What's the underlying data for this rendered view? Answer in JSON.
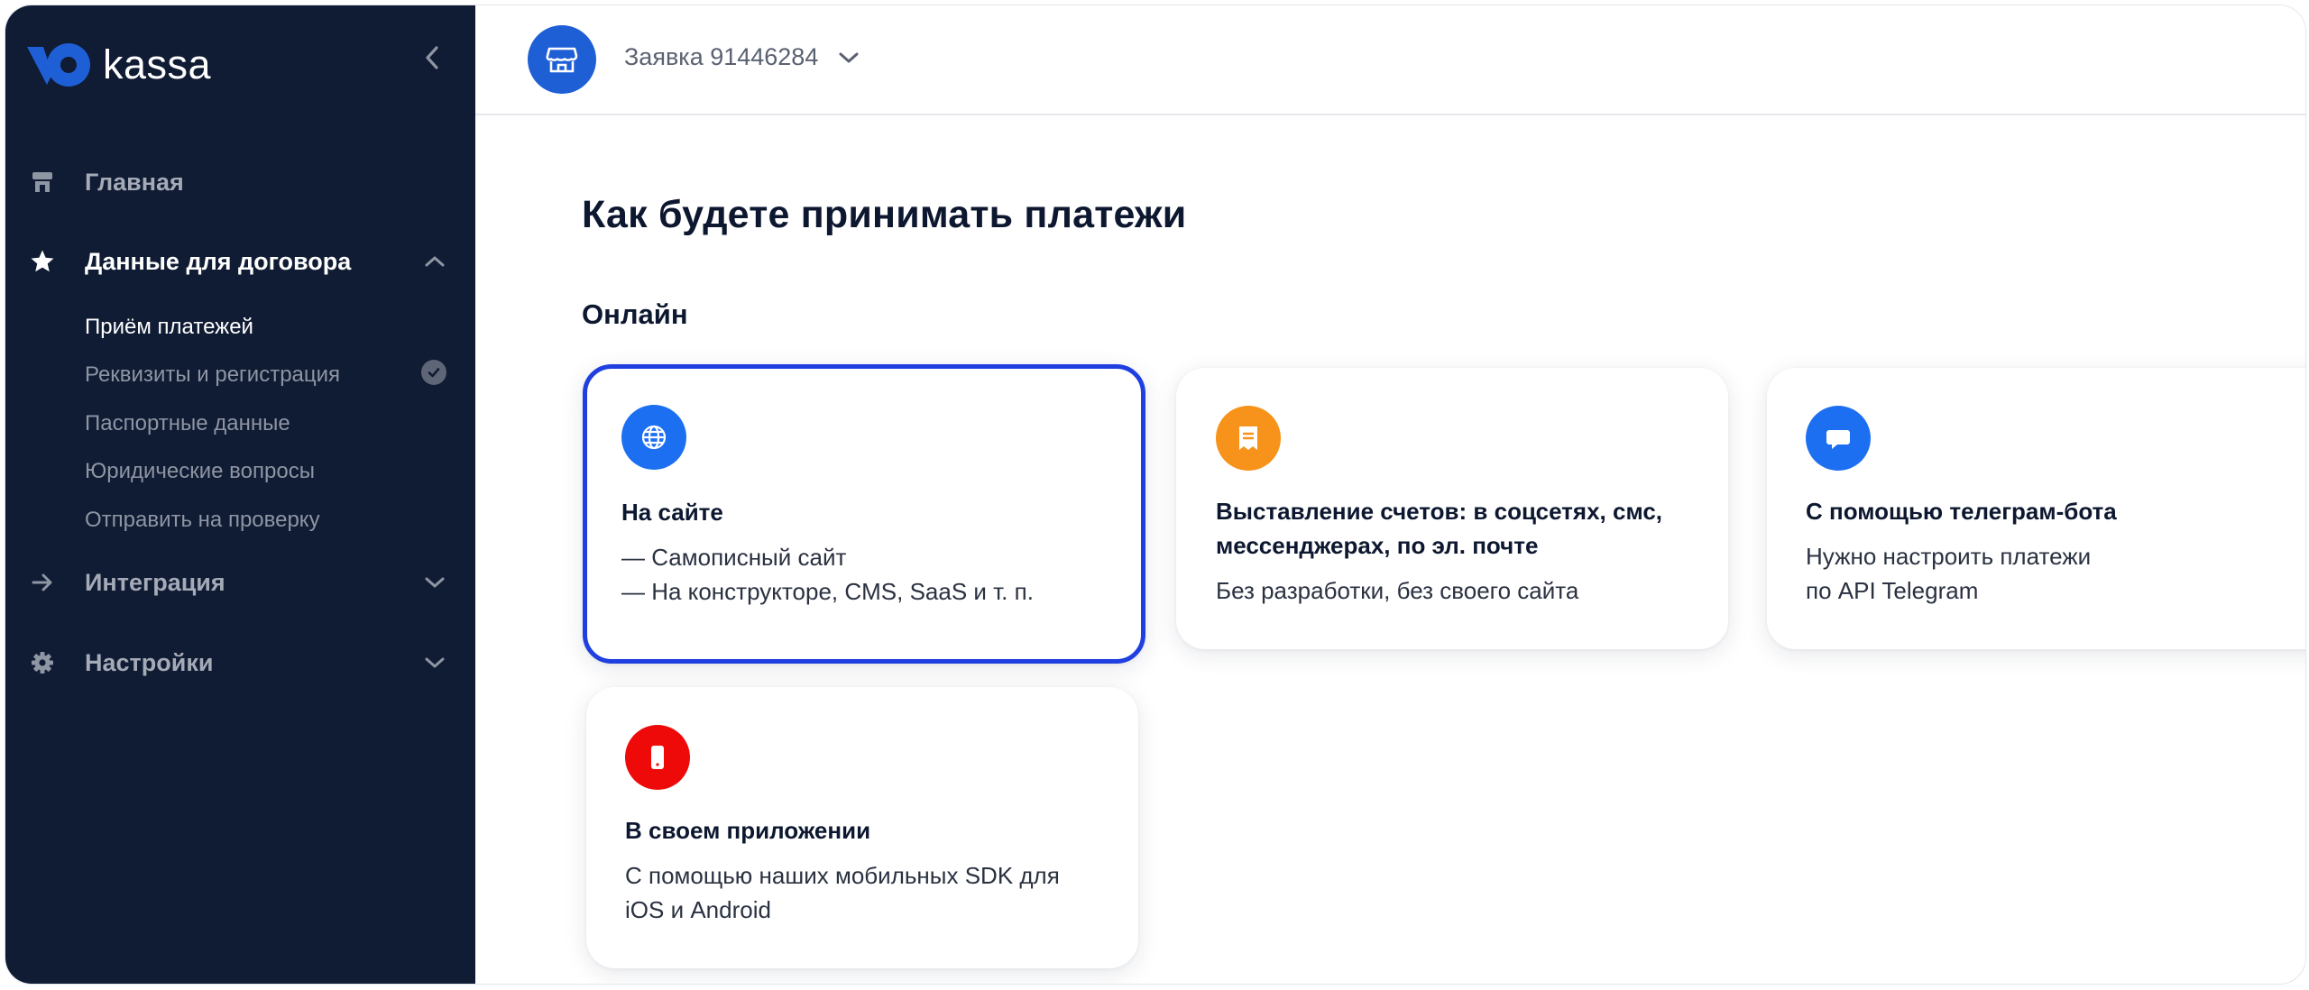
{
  "brand": {
    "logo_text": "kassa",
    "accent": "#1f5fd6",
    "sidebar_bg": "#101b34"
  },
  "sidebar": {
    "items": [
      {
        "label": "Главная",
        "icon": "storefront-icon"
      },
      {
        "label": "Данные для договора",
        "icon": "star-icon",
        "expanded": true,
        "subitems": [
          {
            "label": "Приём платежей",
            "active": true
          },
          {
            "label": "Реквизиты и регистрация",
            "completed": true
          },
          {
            "label": "Паспортные данные"
          },
          {
            "label": "Юридические вопросы"
          },
          {
            "label": "Отправить на проверку"
          }
        ]
      },
      {
        "label": "Интеграция",
        "icon": "arrow-right-icon",
        "expanded": false
      },
      {
        "label": "Настройки",
        "icon": "gear-icon",
        "expanded": false
      }
    ]
  },
  "header": {
    "application_label": "Заявка 91446284"
  },
  "main": {
    "title": "Как будете принимать платежи",
    "section": "Онлайн",
    "cards": [
      {
        "title": "На сайте",
        "lines": [
          "— Самописный сайт",
          "— На конструкторе, CMS, SaaS и т. п."
        ],
        "icon": "globe-icon",
        "color": "#1d6ff2",
        "selected": true
      },
      {
        "title_lines": [
          "Выставление счетов: в соцсетях, смс,",
          "мессенджерах, по эл. почте"
        ],
        "lines": [
          "Без разработки, без своего сайта"
        ],
        "icon": "invoice-icon",
        "color": "#f7931a"
      },
      {
        "title": "С помощью телеграм-бота",
        "lines": [
          "Нужно настроить платежи",
          "по API Telegram"
        ],
        "icon": "chat-bubble-icon",
        "color": "#1d6ff2"
      },
      {
        "title": "В своем приложении",
        "lines": [
          "С помощью наших мобильных SDK для",
          "iOS и Android"
        ],
        "icon": "smartphone-icon",
        "color": "#ef0a0a"
      }
    ]
  }
}
